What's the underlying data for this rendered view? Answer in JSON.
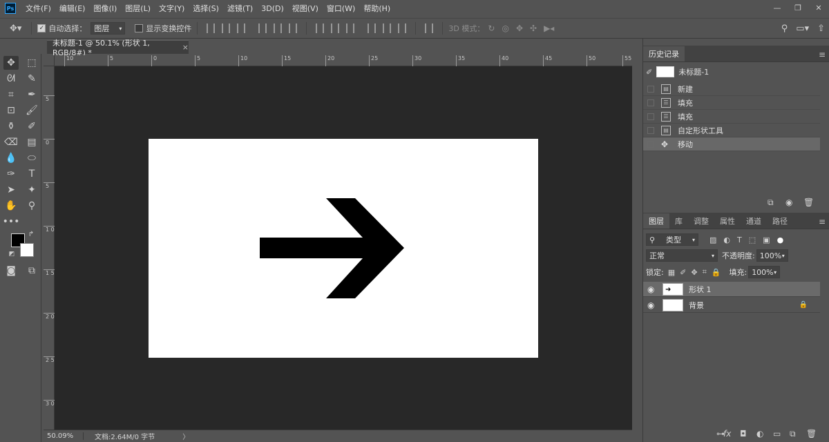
{
  "app": {
    "logo_text": "Ps"
  },
  "menu": [
    "文件(F)",
    "编辑(E)",
    "图像(I)",
    "图层(L)",
    "文字(Y)",
    "选择(S)",
    "滤镜(T)",
    "3D(D)",
    "视图(V)",
    "窗口(W)",
    "帮助(H)"
  ],
  "window_controls": {
    "minimize": "—",
    "restore": "❐",
    "close": "✕"
  },
  "options_bar": {
    "auto_select_label": "自动选择：",
    "auto_select_value": "图层",
    "show_transform_label": "显示变换控件",
    "mode_3d_label": "3D 模式："
  },
  "document": {
    "tab_title": "未标题-1 @ 50.1% (形状 1, RGB/8#) *",
    "tab_close": "×"
  },
  "rulers": {
    "h_ticks": [
      "10",
      "5",
      "0",
      "5",
      "10",
      "15",
      "20",
      "25",
      "30",
      "35",
      "40",
      "45",
      "50",
      "55"
    ],
    "v_ticks": [
      "5",
      "0",
      "5",
      "1 0",
      "1 5",
      "2 0",
      "2 5",
      "3 0"
    ]
  },
  "status": {
    "zoom": "50.09%",
    "doc_info": "文档:2.64M/0 字节",
    "arrow": "〉"
  },
  "history": {
    "tab": "历史记录",
    "snapshot_name": "未标题-1",
    "items": [
      "新建",
      "填充",
      "填充",
      "自定形状工具",
      "移动"
    ],
    "selected_index": 4
  },
  "layers": {
    "tabs": [
      "图层",
      "库",
      "调整",
      "属性",
      "通道",
      "路径"
    ],
    "filter_label": "类型",
    "blend_mode": "正常",
    "opacity_label": "不透明度:",
    "opacity_value": "100%",
    "lock_label": "锁定:",
    "fill_label": "填充:",
    "fill_value": "100%",
    "items": [
      {
        "name": "形状 1",
        "selected": true
      },
      {
        "name": "背景",
        "selected": false,
        "locked": true
      }
    ]
  },
  "colors": {
    "foreground": "#000000",
    "background": "#ffffff",
    "accent": "#31a8ff"
  }
}
